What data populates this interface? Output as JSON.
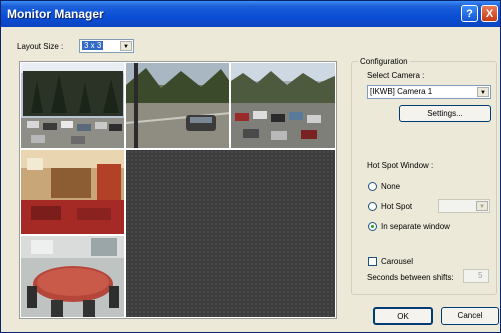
{
  "window": {
    "title": "Monitor Manager"
  },
  "layout": {
    "label": "Layout Size :",
    "value": "3 x 3"
  },
  "config": {
    "legend": "Configuration",
    "select_camera_label": "Select Camera :",
    "camera_value": "[IKWB] Camera 1",
    "settings_label": "Settings...",
    "hotspot_window_label": "Hot Spot Window :",
    "options": {
      "none": "None",
      "hot_spot": "Hot Spot",
      "separate": "In separate window"
    },
    "selected_option": "In separate window",
    "carousel_label": "Carousel",
    "carousel_checked": false,
    "seconds_label": "Seconds between shifts:",
    "seconds_value": "5"
  },
  "buttons": {
    "ok": "OK",
    "cancel": "Cancel"
  },
  "icons": {
    "help": "?",
    "close": "X"
  },
  "colors": {
    "titlebar": "#0a4fd6",
    "empty_cell": "#3d3d3d",
    "dialog": "#ece9d8"
  }
}
